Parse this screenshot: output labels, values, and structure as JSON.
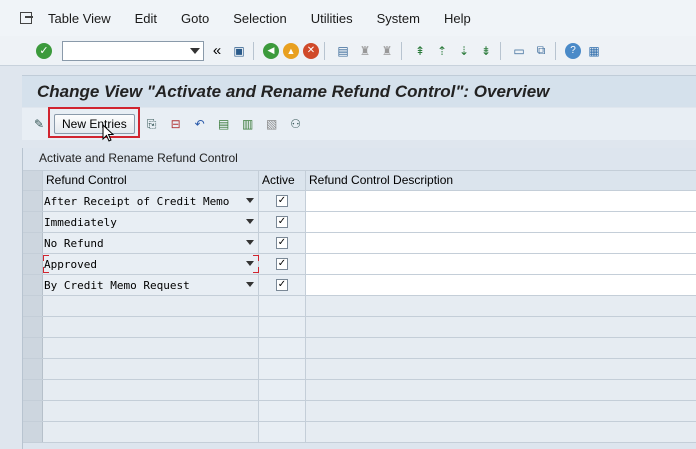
{
  "menu": [
    "Table View",
    "Edit",
    "Goto",
    "Selection",
    "Utilities",
    "System",
    "Help"
  ],
  "screen": {
    "title": "Change View \"Activate and Rename Refund Control\": Overview"
  },
  "app_toolbar": {
    "new_entries": "New Entries"
  },
  "table": {
    "title": "Activate and Rename Refund Control",
    "columns": [
      "Refund Control",
      "Active",
      "Refund Control Description"
    ],
    "rows": [
      {
        "control": "After Receipt of Credit Memo",
        "active": "✓",
        "description": ""
      },
      {
        "control": "Immediately",
        "active": "✓",
        "description": ""
      },
      {
        "control": "No Refund",
        "active": "✓",
        "description": ""
      },
      {
        "control": "Approved",
        "active": "✓",
        "description": ""
      },
      {
        "control": "By Credit Memo Request",
        "active": "✓",
        "description": ""
      }
    ]
  }
}
